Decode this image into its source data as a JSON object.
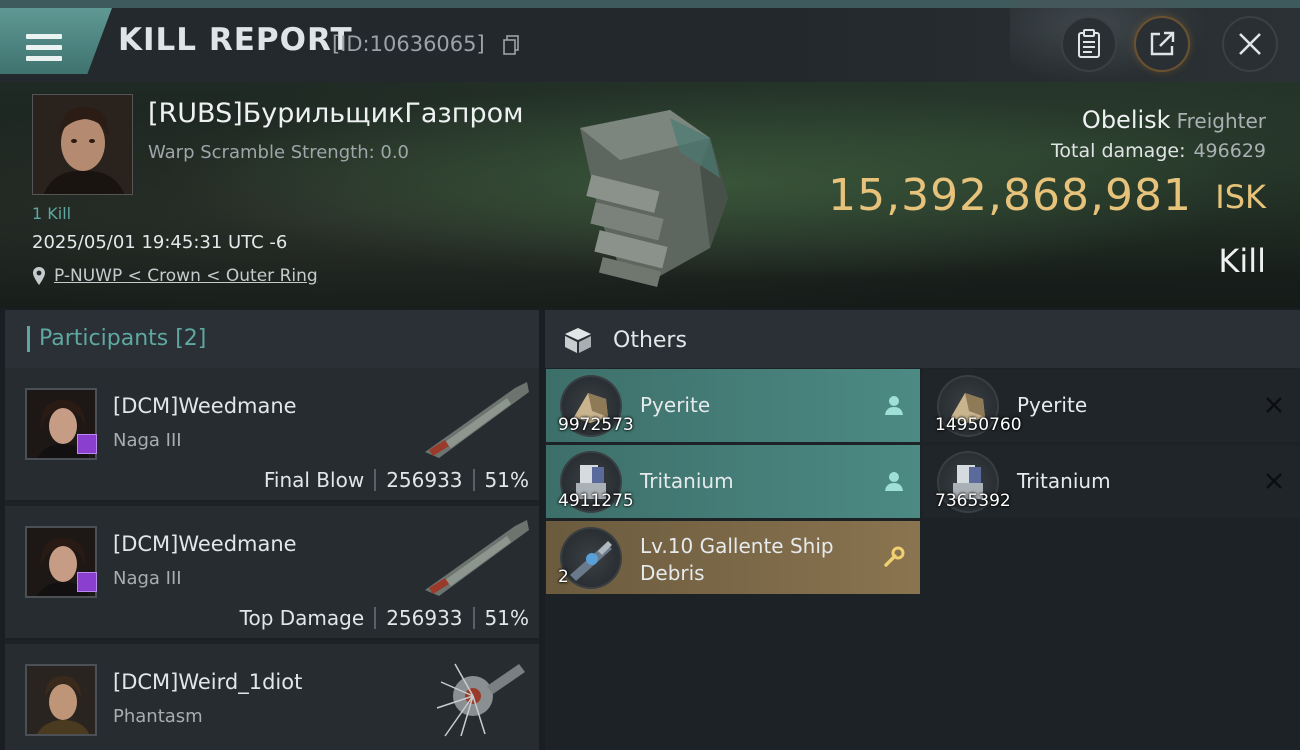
{
  "header": {
    "title": "KILL REPORT",
    "report_id": "[ID:10636065]",
    "icons": [
      "menu-icon",
      "copy-icon",
      "clipboard-icon",
      "share-icon",
      "close-icon"
    ]
  },
  "victim": {
    "name": "[RUBS]БурильщикГазпром",
    "warp_scramble": "Warp Scramble Strength: 0.0",
    "kill_count": "1 Kill",
    "timestamp": "2025/05/01 19:45:31 UTC -6",
    "location": "P-NUWP < Crown < Outer Ring",
    "ship_name": "Obelisk",
    "ship_class": "Freighter",
    "total_damage_label": "Total damage:",
    "total_damage_value": "496629",
    "isk_value": "15,392,868,981",
    "isk_unit": "ISK",
    "result": "Kill"
  },
  "participants": {
    "title": "Participants [2]",
    "rows": [
      {
        "name": "[DCM]Weedmane",
        "ship": "Naga III",
        "role": "Final Blow",
        "damage": "256933",
        "percent": "51%"
      },
      {
        "name": "[DCM]Weedmane",
        "ship": "Naga III",
        "role": "Top Damage",
        "damage": "256933",
        "percent": "51%"
      },
      {
        "name": "[DCM]Weird_1diot",
        "ship": "Phantasm"
      }
    ]
  },
  "others": {
    "title": "Others",
    "items": [
      {
        "name": "Pyerite",
        "qty": "9972573",
        "state": "dropped",
        "icon": "pyerite-icon"
      },
      {
        "name": "Pyerite",
        "qty": "14950760",
        "state": "destroyed",
        "icon": "pyerite-icon"
      },
      {
        "name": "Tritanium",
        "qty": "4911275",
        "state": "dropped",
        "icon": "tritanium-icon"
      },
      {
        "name": "Tritanium",
        "qty": "7365392",
        "state": "destroyed",
        "icon": "tritanium-icon"
      },
      {
        "name": "Lv.10 Gallente Ship Debris",
        "qty": "2",
        "state": "salvage",
        "icon": "ship-debris-icon"
      }
    ]
  },
  "colors": {
    "accent_teal": "#5fa8a2",
    "isk_gold": "#e6c27a",
    "dropped_row": "#4d8a84",
    "salvage_row": "#8a7450"
  }
}
